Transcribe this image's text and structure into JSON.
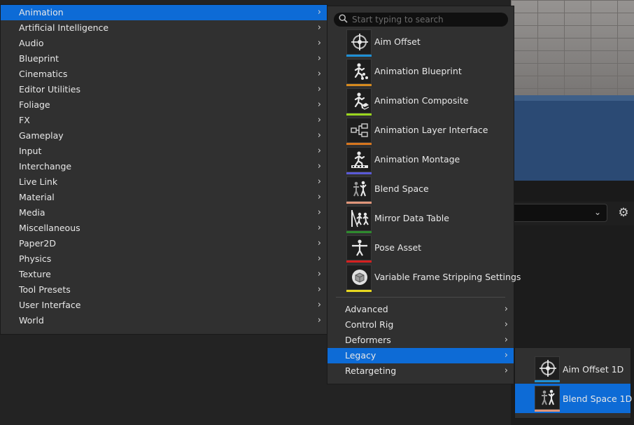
{
  "categories": [
    {
      "label": "Animation",
      "selected": true
    },
    {
      "label": "Artificial Intelligence"
    },
    {
      "label": "Audio"
    },
    {
      "label": "Blueprint"
    },
    {
      "label": "Cinematics"
    },
    {
      "label": "Editor Utilities"
    },
    {
      "label": "Foliage"
    },
    {
      "label": "FX"
    },
    {
      "label": "Gameplay"
    },
    {
      "label": "Input"
    },
    {
      "label": "Interchange"
    },
    {
      "label": "Live Link"
    },
    {
      "label": "Material"
    },
    {
      "label": "Media"
    },
    {
      "label": "Miscellaneous"
    },
    {
      "label": "Paper2D"
    },
    {
      "label": "Physics"
    },
    {
      "label": "Texture"
    },
    {
      "label": "Tool Presets"
    },
    {
      "label": "User Interface"
    },
    {
      "label": "World"
    }
  ],
  "search": {
    "placeholder": "Start typing to search",
    "value": ""
  },
  "assets": [
    {
      "label": "Aim Offset",
      "icon": "aim-offset-icon",
      "color": "#1e90d6"
    },
    {
      "label": "Animation Blueprint",
      "icon": "animation-blueprint-icon",
      "color": "#d68a1e"
    },
    {
      "label": "Animation Composite",
      "icon": "animation-composite-icon",
      "color": "#9ad61e"
    },
    {
      "label": "Animation Layer Interface",
      "icon": "animation-layer-interface-icon",
      "color": "#d6761e"
    },
    {
      "label": "Animation Montage",
      "icon": "animation-montage-icon",
      "color": "#5a5ad6"
    },
    {
      "label": "Blend Space",
      "icon": "blend-space-icon",
      "color": "#e0967a"
    },
    {
      "label": "Mirror Data Table",
      "icon": "mirror-data-table-icon",
      "color": "#2e8a2e"
    },
    {
      "label": "Pose Asset",
      "icon": "pose-asset-icon",
      "color": "#d62020"
    },
    {
      "label": "Variable Frame Stripping Settings",
      "icon": "variable-frame-stripping-icon",
      "color": "#e8d820"
    }
  ],
  "subcategories": [
    {
      "label": "Advanced"
    },
    {
      "label": "Control Rig"
    },
    {
      "label": "Deformers"
    },
    {
      "label": "Legacy",
      "selected": true
    },
    {
      "label": "Retargeting"
    }
  ],
  "legacy_assets": [
    {
      "label": "Aim Offset 1D",
      "icon": "aim-offset-1d-icon",
      "color": "#1e90d6"
    },
    {
      "label": "Blend Space 1D",
      "icon": "blend-space-1d-icon",
      "color": "#e0967a",
      "selected": true
    }
  ],
  "arrow_glyph": "›",
  "colors": {
    "selection": "#0d6bd6",
    "menu_bg": "#303030"
  }
}
